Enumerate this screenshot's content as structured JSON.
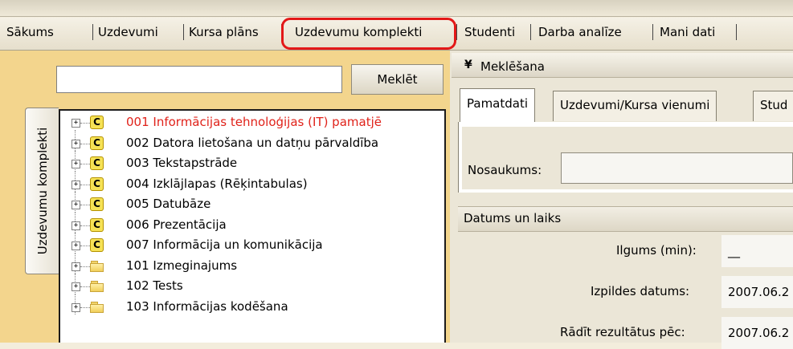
{
  "nav": {
    "tabs": [
      {
        "label": "Sākums"
      },
      {
        "label": "Uzdevumi"
      },
      {
        "label": "Kursa plāns"
      },
      {
        "label": "Uzdevumu komplekti"
      },
      {
        "label": "Studenti"
      },
      {
        "label": "Darba analīze"
      },
      {
        "label": "Mani dati"
      }
    ],
    "selected_index": 3,
    "highlight_color": "#e31818"
  },
  "left": {
    "search": {
      "value": "",
      "button_label": "Meklēt"
    },
    "side_tab_label": "Uzdevumu komplekti",
    "tree": [
      {
        "label": "001 Informācijas tehnoloģijas (IT) pamatjē",
        "icon": "c-icon",
        "active": true
      },
      {
        "label": "002 Datora lietošana un datņu pārvaldība",
        "icon": "c-icon"
      },
      {
        "label": "003 Tekstapstrāde",
        "icon": "c-icon"
      },
      {
        "label": "004 Izklājlapas (Rēķintabulas)",
        "icon": "c-icon"
      },
      {
        "label": "005 Datubāze",
        "icon": "c-icon"
      },
      {
        "label": "006 Prezentācija",
        "icon": "c-icon"
      },
      {
        "label": "007 Informācija un komunikācija",
        "icon": "c-icon"
      },
      {
        "label": "101 Izmeginajums",
        "icon": "folder-icon"
      },
      {
        "label": "102 Tests",
        "icon": "folder-icon"
      },
      {
        "label": "103 Informācijas kodēšana",
        "icon": "folder-icon"
      }
    ],
    "expand_glyph": "+",
    "c_letter": "C",
    "active_color": "#e0221a"
  },
  "right": {
    "header": {
      "chevron": "¥",
      "title": "Meklēšana"
    },
    "tabs": [
      {
        "label": "Pamatdati"
      },
      {
        "label": "Uzdevumi/Kursa vienumi"
      },
      {
        "label": "Stud"
      }
    ],
    "fields": {
      "name_label": "Nosaukums:",
      "name_value": ""
    },
    "section": {
      "title": "Datums un laiks",
      "rows": [
        {
          "label": "Ilgums (min):",
          "value": "__"
        },
        {
          "label": "Izpildes datums:",
          "value": "2007.06.2"
        },
        {
          "label": "Rādīt rezultātus pēc:",
          "value": "2007.06.2"
        }
      ]
    }
  }
}
